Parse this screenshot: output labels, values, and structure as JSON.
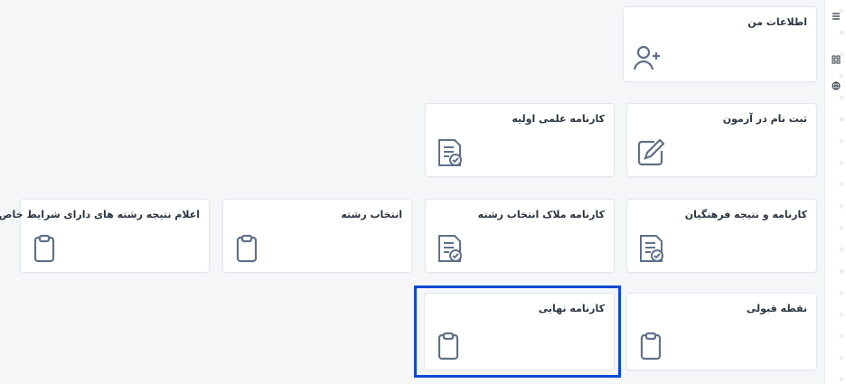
{
  "cards": {
    "my_info": {
      "title": "اطلاعات من",
      "icon": "user-add-icon"
    },
    "exam_registration": {
      "title": "ثبت نام در آزمون",
      "icon": "edit-icon"
    },
    "initial_scorecard": {
      "title": "کارنامه علمی اولیه",
      "icon": "document-check-icon"
    },
    "cultural_scorecard": {
      "title": "کارنامه و نتیجه فرهنگیان",
      "icon": "document-check-icon"
    },
    "major_selection_scorecard": {
      "title": "کارنامه ملاک انتخاب رشته",
      "icon": "document-check-icon"
    },
    "major_selection": {
      "title": "انتخاب رشته",
      "icon": "clipboard-icon"
    },
    "special_conditions_result": {
      "title": "اعلام نتیجه رشته های دارای شرایط خاص",
      "icon": "clipboard-icon"
    },
    "acceptance_score": {
      "title": "نقطه قبولی",
      "icon": "clipboard-icon"
    },
    "final_scorecard": {
      "title": "کارنامه نهایی",
      "icon": "clipboard-icon"
    }
  },
  "rail": {
    "icons": [
      "menu-icon",
      "grid-icon",
      "globe-icon"
    ]
  },
  "colors": {
    "selection": "#0b4bd1",
    "icon_stroke": "#5f7188"
  }
}
